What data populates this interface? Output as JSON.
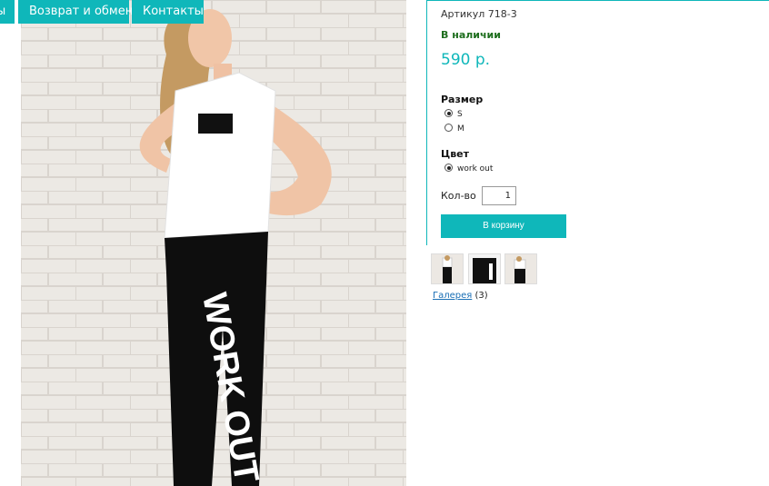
{
  "nav": {
    "items": [
      {
        "label": "ы"
      },
      {
        "label": "Возврат и обмен"
      },
      {
        "label": "Контакты"
      }
    ]
  },
  "product": {
    "sku": "Артикул 718-3",
    "stock": "В наличии",
    "price": "590 р.",
    "photo_print": "WORK OUT",
    "size": {
      "label": "Размер",
      "options": [
        {
          "label": "S",
          "selected": true
        },
        {
          "label": "M",
          "selected": false
        }
      ]
    },
    "color": {
      "label": "Цвет",
      "options": [
        {
          "label": "work out",
          "selected": true
        }
      ]
    },
    "quantity": {
      "label": "Кол-во",
      "value": "1"
    },
    "cart_button": "В корзину",
    "gallery": {
      "link": "Галерея",
      "count": "(3)"
    }
  },
  "colors": {
    "accent": "#0fb7ba",
    "stock_green": "#1e6e1e",
    "link": "#1a6fb5"
  }
}
